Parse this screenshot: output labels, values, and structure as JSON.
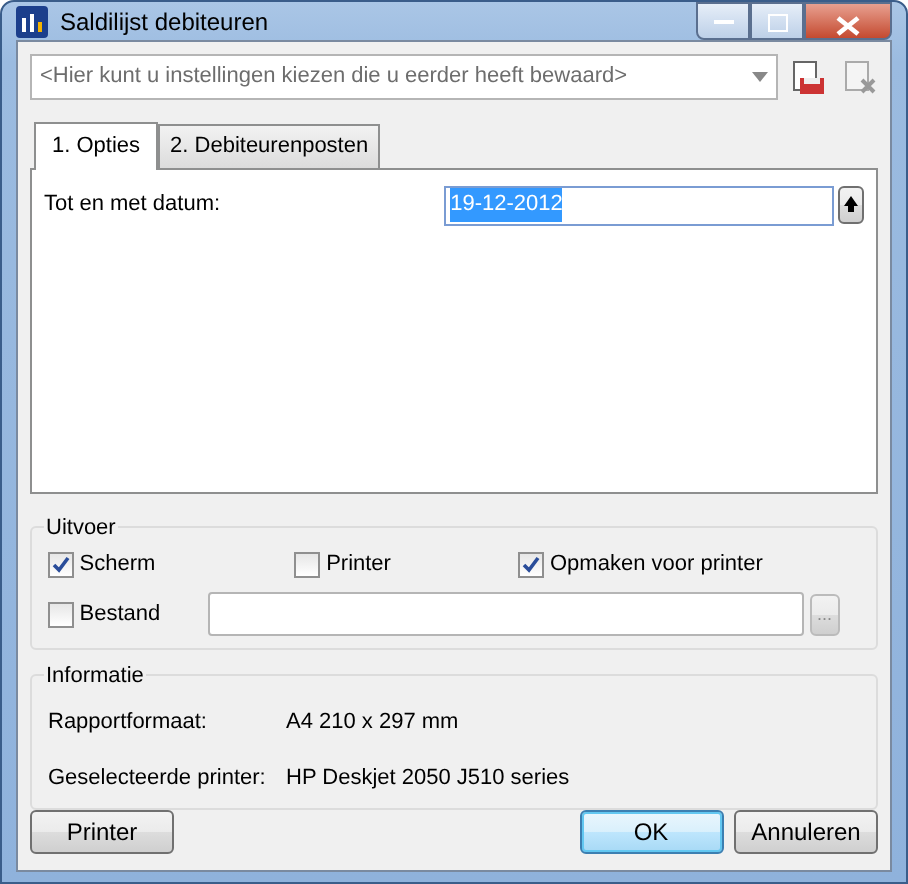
{
  "window": {
    "title": "Saldilijst debiteuren"
  },
  "settings_combo": {
    "placeholder": "<Hier kunt u instellingen kiezen die u eerder heeft bewaard>"
  },
  "tabs": [
    {
      "label": "1. Opties",
      "selected": true
    },
    {
      "label": "2. Debiteurenposten",
      "selected": false
    }
  ],
  "date_field": {
    "label": "Tot en met datum:",
    "value": "19-12-2012",
    "text_selected": true
  },
  "output": {
    "title": "Uitvoer",
    "options": [
      {
        "label": "Scherm",
        "checked": true
      },
      {
        "label": "Printer",
        "checked": false
      },
      {
        "label": "Opmaken voor printer",
        "checked": true
      }
    ],
    "file": {
      "label": "Bestand",
      "checked": false,
      "browse": "..."
    }
  },
  "info": {
    "title": "Informatie",
    "rows": [
      {
        "label": "Rapportformaat:",
        "value": "A4 210 x 297 mm"
      },
      {
        "label": "Geselecteerde printer:",
        "value": "HP Deskjet 2050 J510 series"
      }
    ]
  },
  "buttons": [
    {
      "label": "Printer",
      "kind": "plain"
    },
    {
      "label": "OK",
      "kind": "default"
    },
    {
      "label": "Annuleren",
      "kind": "plain"
    }
  ]
}
